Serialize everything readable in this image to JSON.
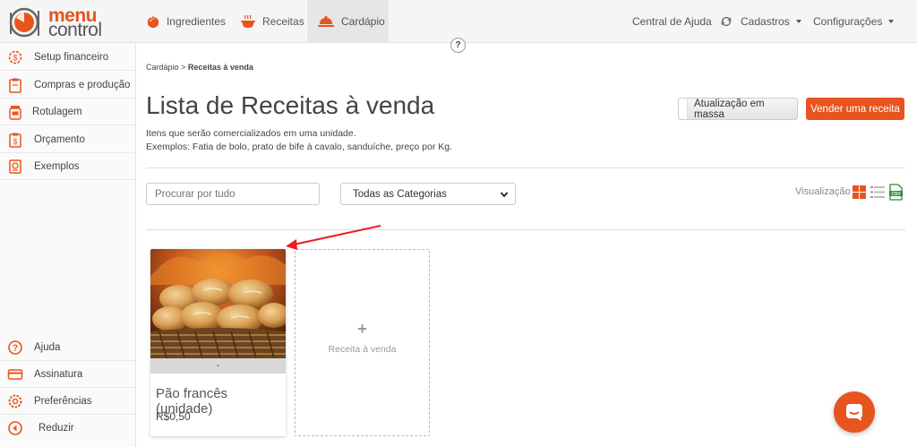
{
  "brand": {
    "name_top": "menu",
    "name_bottom": "control",
    "accent": "#e8541e"
  },
  "nav": {
    "items": [
      {
        "label": "Ingredientes",
        "icon": "tomato-icon"
      },
      {
        "label": "Receitas",
        "icon": "cooking-pot-icon"
      },
      {
        "label": "Cardápio",
        "icon": "cloche-icon"
      }
    ],
    "right": [
      {
        "label": "Central de Ajuda",
        "icon": "refresh-icon"
      },
      {
        "label": "Cadastros",
        "icon": "caret-down-icon"
      },
      {
        "label": "Configurações",
        "icon": "caret-down-icon"
      }
    ],
    "help_badge": "?"
  },
  "sidebar": {
    "top_items": [
      {
        "label": "Setup financeiro",
        "icon": "gear-dollar-icon"
      },
      {
        "label": "Compras e produção",
        "icon": "clipboard-icon"
      },
      {
        "label": "Rotulagem",
        "icon": "jar-label-icon"
      },
      {
        "label": "Orçamento",
        "icon": "budget-document-icon"
      },
      {
        "label": "Exemplos",
        "icon": "examples-icon"
      }
    ],
    "bottom_items": [
      {
        "label": "Ajuda",
        "icon": "question-icon"
      },
      {
        "label": "Assinatura",
        "icon": "credit-card-icon"
      },
      {
        "label": "Preferências",
        "icon": "gear-icon"
      },
      {
        "label": "Reduzir",
        "icon": "collapse-left-icon"
      }
    ]
  },
  "breadcrumb": {
    "parent": "Cardápio",
    "separator": ">",
    "current": "Receitas à venda"
  },
  "page": {
    "title": "Lista de Receitas à venda",
    "description_line1": "Itens que serão comercializados em uma unidade.",
    "description_line2": "Exemplos: Fatia de bolo, prato de bife à cavalo, sanduíche, preço por Kg."
  },
  "actions": {
    "mass_update": "Atualização em massa",
    "sell_recipe": "Vender uma receita"
  },
  "filters": {
    "search_placeholder": "Procurar por tudo",
    "category_selected": "Todas as Categorias",
    "visualization_label": "Visualização",
    "view_icons": [
      "grid-view-icon",
      "list-view-icon",
      "csv-export-icon"
    ]
  },
  "cards": [
    {
      "name": "Pão francês (unidade)",
      "price": "R$0,50",
      "strip_text": "-",
      "image": "bread-basket-photo"
    }
  ],
  "add_card": {
    "plus": "+",
    "label": "Receita à venda"
  },
  "chat_widget": {
    "icon": "chat-icon"
  }
}
